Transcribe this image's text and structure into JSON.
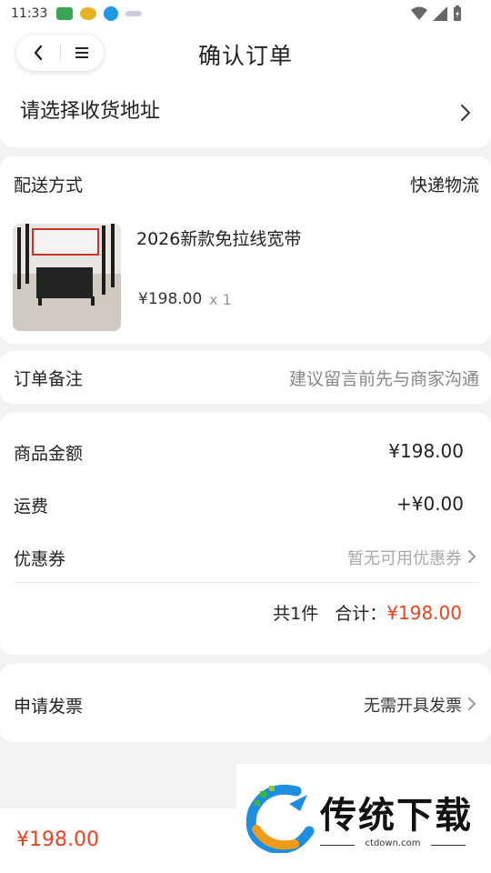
{
  "status_bar": {
    "time": "11:33"
  },
  "header": {
    "title": "确认订单"
  },
  "address": {
    "prompt": "请选择收货地址"
  },
  "shipping": {
    "label": "配送方式",
    "value": "快递物流"
  },
  "product": {
    "name": "2026新款免拉线宽带",
    "price": "¥198.00",
    "qty": "x 1"
  },
  "note": {
    "label": "订单备注",
    "placeholder": "建议留言前先与商家沟通"
  },
  "amounts": {
    "goods_label": "商品金额",
    "goods_value": "¥198.00",
    "freight_label": "运费",
    "freight_value": "+¥0.00",
    "coupon_label": "优惠券",
    "coupon_value": "暂无可用优惠券",
    "count_text": "共1件",
    "total_label": "合计：",
    "total_value": "¥198.00"
  },
  "invoice": {
    "label": "申请发票",
    "value": "无需开具发票"
  },
  "bottom": {
    "price": "¥198.00"
  },
  "watermark": {
    "text": "传统下载",
    "url": "ctdown.com"
  },
  "colors": {
    "accent_red": "#e8421f",
    "background": "#f3f3f3"
  }
}
